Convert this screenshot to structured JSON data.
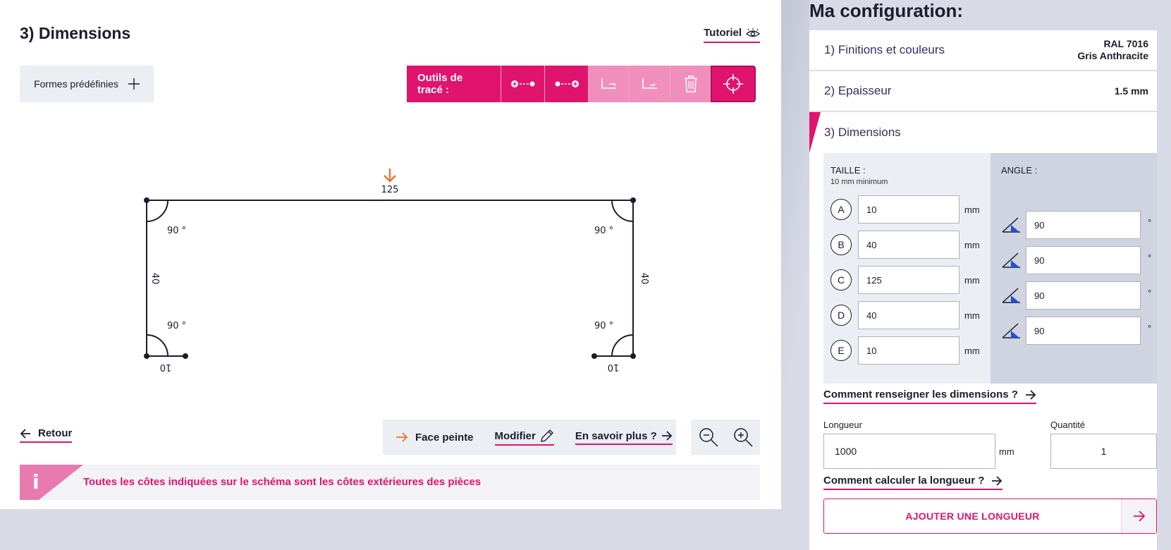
{
  "left": {
    "title": "3) Dimensions",
    "tutorial": "Tutoriel",
    "predefined_shapes": "Formes prédéfinies",
    "toolbar_label": "Outils de tracé :",
    "tool_icons": [
      "add-point-start-icon",
      "add-point-end-icon",
      "angle-inner-icon",
      "angle-outer-icon",
      "trash-icon",
      "crosshair-icon"
    ],
    "drawing": {
      "top_label": "125",
      "left_label": "40",
      "right_label": "40",
      "bottom_left_label": "10",
      "bottom_right_label": "10",
      "angle_tl": "90 °",
      "angle_tr": "90 °",
      "angle_bl": "90 °",
      "angle_br": "90 °"
    },
    "back": "Retour",
    "face_painted": "Face peinte",
    "modify": "Modifier",
    "learn_more": "En savoir plus ?",
    "info_icon": "i",
    "info_text": "Toutes les côtes indiquées sur le schéma sont les côtes extérieures des pièces"
  },
  "right": {
    "title": "Ma configuration:",
    "step1_label": "1) Finitions et couleurs",
    "step1_value_line1": "RAL 7016",
    "step1_value_line2": "Gris Anthracite",
    "step2_label": "2) Epaisseur",
    "step2_value": "1.5 mm",
    "step3_label": "3) Dimensions",
    "size_header": "TAILLE :",
    "size_sub": "10 mm minimum",
    "angle_header": "ANGLE :",
    "sizes": [
      {
        "letter": "A",
        "value": "10",
        "unit": "mm"
      },
      {
        "letter": "B",
        "value": "40",
        "unit": "mm"
      },
      {
        "letter": "C",
        "value": "125",
        "unit": "mm"
      },
      {
        "letter": "D",
        "value": "40",
        "unit": "mm"
      },
      {
        "letter": "E",
        "value": "10",
        "unit": "mm"
      }
    ],
    "angles": [
      {
        "value": "90",
        "unit": "°"
      },
      {
        "value": "90",
        "unit": "°"
      },
      {
        "value": "90",
        "unit": "°"
      },
      {
        "value": "90",
        "unit": "°"
      }
    ],
    "how_dimensions": "Comment renseigner les dimensions ?",
    "length_label": "Longueur",
    "length_value": "1000",
    "length_unit": "mm",
    "quantity_label": "Quantité",
    "quantity_value": "1",
    "how_length": "Comment calculer la longueur ?",
    "add_length": "AJOUTER UNE LONGUEUR"
  },
  "colors": {
    "accent": "#e0136e",
    "accent_light": "#f08fbb",
    "orange": "#f07030",
    "angle_blue": "#1f4fe0"
  }
}
